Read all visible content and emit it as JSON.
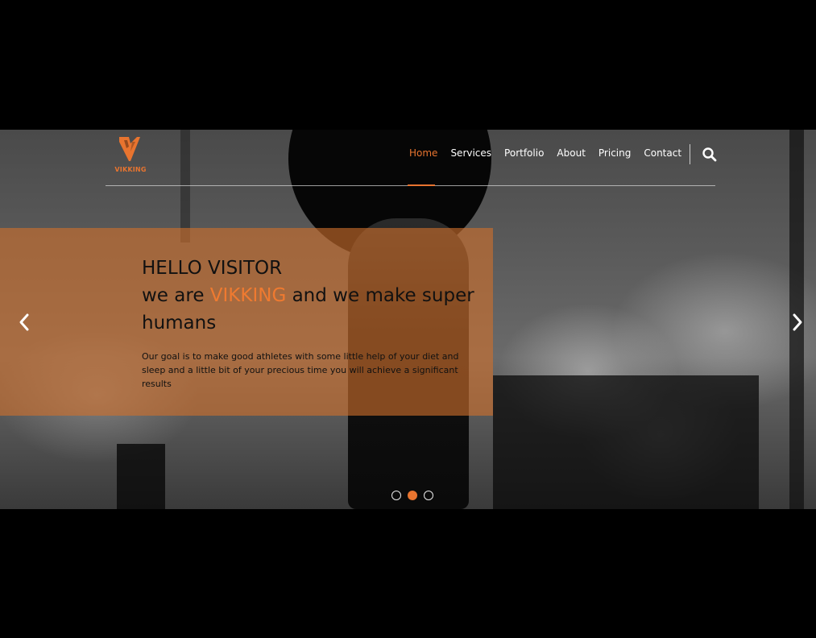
{
  "header": {
    "logo_text": "VIKKING",
    "nav": [
      {
        "label": "Home",
        "active": true
      },
      {
        "label": "Services",
        "active": false
      },
      {
        "label": "Portfolio",
        "active": false
      },
      {
        "label": "About",
        "active": false
      },
      {
        "label": "Pricing",
        "active": false
      },
      {
        "label": "Contact",
        "active": false
      }
    ],
    "search_icon": "search-icon"
  },
  "hero": {
    "title_line1": "HELLO VISITOR",
    "title_line2_prefix": "we are ",
    "title_brand": "VIKKING",
    "title_line2_suffix": " and we make super",
    "title_line3": "humans",
    "description": "Our goal is to make good athletes with some little help of your diet and sleep and a little bit of your precious time you will achieve a significant results",
    "prev_icon": "chevron-left-icon",
    "next_icon": "chevron-right-icon",
    "slides_total": 3,
    "active_slide": 2
  },
  "colors": {
    "accent": "#e8742f",
    "overlay": "#ce6f2c",
    "background": "#000000"
  }
}
